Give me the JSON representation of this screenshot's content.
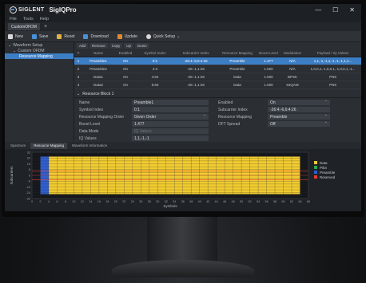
{
  "window": {
    "brand": "SIGLENT",
    "app_title": "SigIQPro",
    "minimize": "—",
    "maximize": "☐",
    "close": "✕"
  },
  "menu": [
    "File",
    "Tools",
    "Help"
  ],
  "tabs": {
    "document": "CustomOFDM",
    "add": "+"
  },
  "toolbar": [
    {
      "label": "New",
      "icon": "new-file-icon",
      "color": "#d9d9d9"
    },
    {
      "label": "Save",
      "icon": "save-icon",
      "color": "#4a90d9"
    },
    {
      "label": "Reset",
      "icon": "reset-icon",
      "color": "#e0b341"
    },
    {
      "label": "Download",
      "icon": "download-icon",
      "color": "#4a90d9"
    },
    {
      "label": "Update",
      "icon": "update-icon",
      "color": "#e08a2e"
    },
    {
      "label": "Quick Setup",
      "icon": "quick-setup-icon",
      "color": "#d9d9d9"
    }
  ],
  "tree": [
    {
      "label": "Waveform Setup",
      "indent": 1,
      "prefix": "⌄"
    },
    {
      "label": "Custom OFDM",
      "indent": 2,
      "prefix": "⌄"
    },
    {
      "label": "Resource Mapping",
      "indent": 3,
      "prefix": "",
      "selected": true
    }
  ],
  "sub_toolbar": [
    "Add",
    "Remove",
    "Copy",
    "Up",
    "Down"
  ],
  "table": {
    "headers": [
      "#",
      "Name",
      "Enabled",
      "Symbol Index",
      "Subcarrier Index",
      "Resource Mapping",
      "Boost Level",
      "Modulation",
      "Payload / IQ Values"
    ],
    "rows": [
      [
        "1",
        "Preamble1",
        "On",
        "0:1",
        "-26:4:-6,6:4:26",
        "Preamble",
        "1.477",
        "N/A",
        "1,1,-1,-1,1,-1,-1,-1,1,1..."
      ],
      [
        "2",
        "Preamble2",
        "On",
        "2:3",
        "-26:-1,1:26",
        "Preamble",
        "1.000",
        "N/A",
        "1,0,0,1,-1,0,0,1,-1,0,0,1,-1..."
      ],
      [
        "3",
        "Data1",
        "On",
        "4:64",
        "-26:-1,1:26",
        "Data",
        "1.000",
        "BPSK",
        "PN9"
      ],
      [
        "4",
        "Data2",
        "On",
        "5:60",
        "-26:-1,1:26",
        "Data",
        "1.000",
        "64QAM",
        "PN9"
      ]
    ]
  },
  "section_title": "Resource Block 1",
  "properties": {
    "name_label": "Name",
    "name_value": "Preamble1",
    "enabled_label": "Enabled",
    "enabled_value": "On",
    "symbol_label": "Symbol Index",
    "symbol_value": "0:1",
    "subcarrier_label": "Subcarrier Index",
    "subcarrier_value": "-26:4:-6,6:4:26",
    "symorder_label": "Resource Mapping Order",
    "symorder_value": "Given Order",
    "mapping_label": "Resource Mapping",
    "mapping_value": "Preamble",
    "boost_label": "Boost Level",
    "boost_value": "1.477",
    "dft_label": "DFT Spread",
    "dft_value": "Off",
    "datamode_label": "Data Mode",
    "datamode_value": "IQ Values",
    "iq_label": "IQ Values",
    "iq_value": "1,1,-1,-1"
  },
  "bottom_tabs": [
    "Spectrum",
    "Resource Mapping",
    "Waveform Information"
  ],
  "chart_data": {
    "type": "heatmap",
    "xlabel": "Symbols",
    "ylabel": "Subcarriers",
    "x_ticks": [
      "0",
      "2",
      "4",
      "6",
      "8",
      "10",
      "12",
      "14",
      "16",
      "18",
      "20",
      "22",
      "24",
      "26",
      "28",
      "30",
      "32",
      "34",
      "36",
      "38",
      "40",
      "42",
      "44",
      "46",
      "48",
      "50",
      "52",
      "54",
      "56",
      "58",
      "60",
      "62",
      "64",
      "66"
    ],
    "y_ticks": [
      "32",
      "28",
      "24",
      "20",
      "16",
      "12",
      "8",
      "4",
      "0",
      "-4",
      "-8",
      "-12",
      "-16",
      "-20",
      "-24",
      "-28",
      "-32"
    ],
    "xlim": [
      0,
      66
    ],
    "ylim": [
      -32,
      32
    ],
    "occupied_subcarriers": [
      -26,
      26
    ],
    "preamble_symbols": [
      2,
      4
    ],
    "data_symbols": [
      4,
      64
    ],
    "legend": [
      {
        "name": "Data",
        "color": "#f2cc30"
      },
      {
        "name": "Pilot",
        "color": "#2fa84f"
      },
      {
        "name": "Preamble",
        "color": "#2f5fd0"
      },
      {
        "name": "Reserved",
        "color": "#e23b3b"
      }
    ]
  }
}
